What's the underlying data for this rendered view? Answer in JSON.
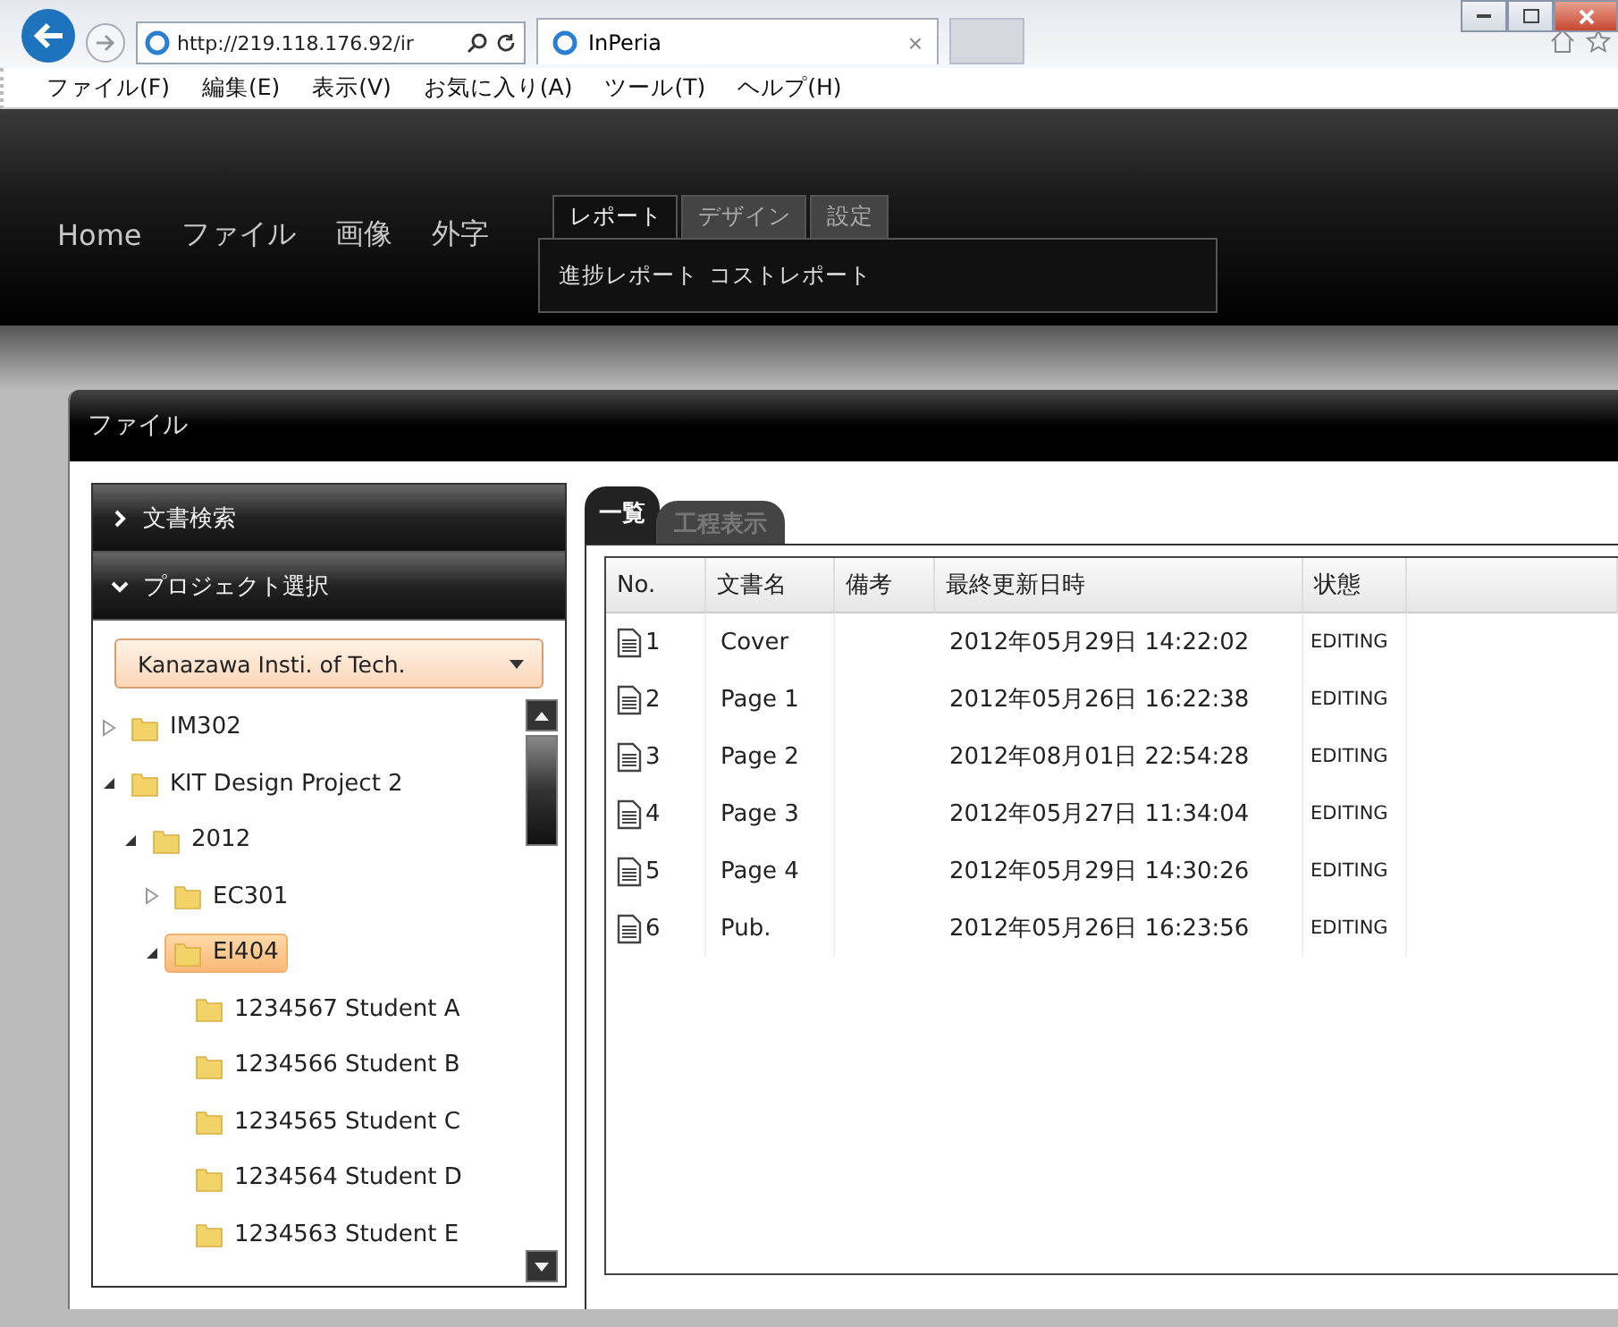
{
  "browser": {
    "address": "http://219.118.176.92/ir",
    "tab_title": "InPeria",
    "tab_close": "×"
  },
  "menu_bar": [
    "ファイル(F)",
    "編集(E)",
    "表示(V)",
    "お気に入り(A)",
    "ツール(T)",
    "ヘルプ(H)"
  ],
  "app_nav": {
    "items": [
      "Home",
      "ファイル",
      "画像",
      "外字"
    ],
    "ribbon_tabs": [
      {
        "label": "レポート",
        "selected": true
      },
      {
        "label": "デザイン",
        "selected": false
      },
      {
        "label": "設定",
        "selected": false
      }
    ],
    "ribbon_items": [
      "進捗レポート",
      "コストレポート"
    ]
  },
  "panel": {
    "title": "ファイル",
    "sidebar": {
      "sections": [
        {
          "label": "文書検索",
          "expanded": false
        },
        {
          "label": "プロジェクト選択",
          "expanded": true
        }
      ],
      "dropdown": {
        "value": "Kanazawa Insti. of Tech."
      },
      "tree": [
        {
          "label": "IM302",
          "expanded": false,
          "selected": false
        },
        {
          "label": "KIT Design Project 2",
          "expanded": true,
          "selected": false,
          "children": [
            {
              "label": "2012",
              "expanded": true,
              "selected": false,
              "children": [
                {
                  "label": "EC301",
                  "expanded": false,
                  "selected": false
                },
                {
                  "label": "EI404",
                  "expanded": true,
                  "selected": true,
                  "children": [
                    {
                      "label": "1234567 Student A",
                      "selected": false
                    },
                    {
                      "label": "1234566 Student B",
                      "selected": false
                    },
                    {
                      "label": "1234565 Student C",
                      "selected": false
                    },
                    {
                      "label": "1234564 Student D",
                      "selected": false
                    },
                    {
                      "label": "1234563 Student E",
                      "selected": false
                    }
                  ]
                }
              ]
            }
          ]
        }
      ]
    },
    "doc_tabs": [
      {
        "label": "一覧",
        "selected": true
      },
      {
        "label": "工程表示",
        "selected": false
      }
    ],
    "table": {
      "columns": [
        "No.",
        "文書名",
        "備考",
        "最終更新日時",
        "状態"
      ],
      "rows": [
        {
          "no": "1",
          "name": "Cover",
          "note": "",
          "updated": "2012年05月29日 14:22:02",
          "status": "EDITING"
        },
        {
          "no": "2",
          "name": "Page 1",
          "note": "",
          "updated": "2012年05月26日 16:22:38",
          "status": "EDITING"
        },
        {
          "no": "3",
          "name": "Page 2",
          "note": "",
          "updated": "2012年08月01日 22:54:28",
          "status": "EDITING"
        },
        {
          "no": "4",
          "name": "Page 3",
          "note": "",
          "updated": "2012年05月27日 11:34:04",
          "status": "EDITING"
        },
        {
          "no": "5",
          "name": "Page 4",
          "note": "",
          "updated": "2012年05月29日 14:30:26",
          "status": "EDITING"
        },
        {
          "no": "6",
          "name": "Pub.",
          "note": "",
          "updated": "2012年05月26日 16:23:56",
          "status": "EDITING"
        }
      ]
    }
  }
}
